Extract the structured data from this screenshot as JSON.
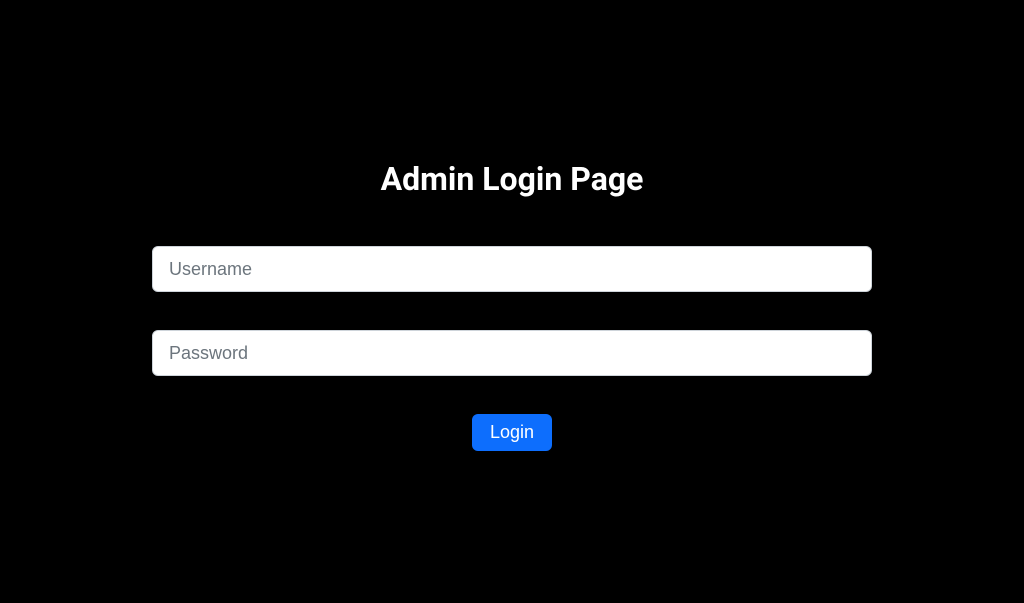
{
  "page": {
    "title": "Admin Login Page"
  },
  "form": {
    "username": {
      "placeholder": "Username",
      "value": ""
    },
    "password": {
      "placeholder": "Password",
      "value": ""
    },
    "submit_label": "Login"
  },
  "colors": {
    "background": "#000000",
    "primary": "#0d6efd",
    "input_bg": "#ffffff",
    "text_light": "#ffffff",
    "placeholder": "#6c757d"
  }
}
